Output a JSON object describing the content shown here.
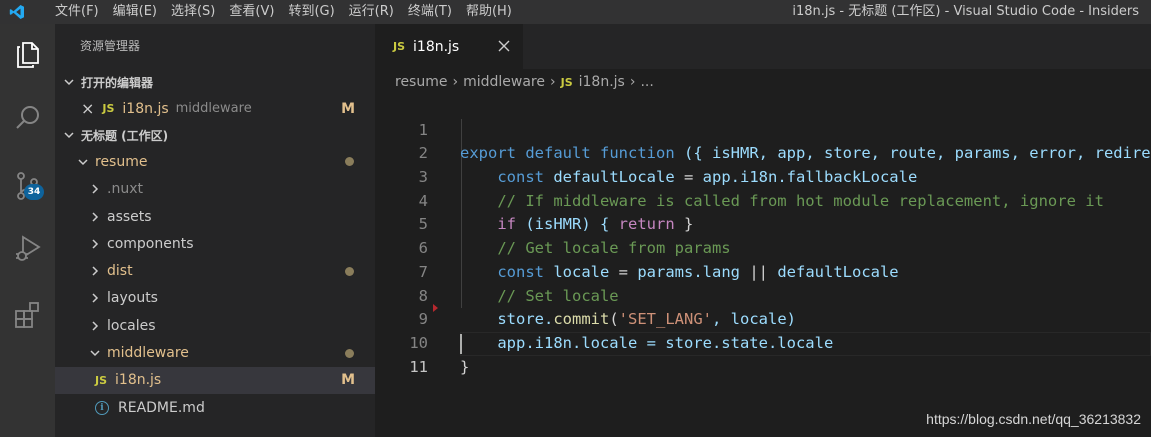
{
  "menu": [
    "文件(F)",
    "编辑(E)",
    "选择(S)",
    "查看(V)",
    "转到(G)",
    "运行(R)",
    "终端(T)",
    "帮助(H)"
  ],
  "window_title": "i18n.js - 无标题 (工作区) - Visual Studio Code - Insiders",
  "activity": {
    "icons": [
      "explorer-icon",
      "search-icon",
      "source-control-icon",
      "run-debug-icon",
      "extensions-icon"
    ],
    "scm_badge": "34"
  },
  "sidebar": {
    "title": "资源管理器",
    "open_editors_header": "打开的编辑器",
    "open_editor": {
      "close": "×",
      "name": "i18n.js",
      "folder": "middleware",
      "status": "M"
    },
    "workspace_header": "无标题 (工作区)",
    "tree": [
      {
        "name": "resume",
        "expanded": true,
        "modified": true
      },
      {
        "name": ".nuxt",
        "dim": true
      },
      {
        "name": "assets"
      },
      {
        "name": "components"
      },
      {
        "name": "dist",
        "modified": true
      },
      {
        "name": "layouts"
      },
      {
        "name": "locales"
      },
      {
        "name": "middleware",
        "expanded": true,
        "modified": true
      },
      {
        "name": "i18n.js",
        "status": "M",
        "selected": true
      },
      {
        "name": "README.md"
      }
    ]
  },
  "editor": {
    "tab_label": "i18n.js",
    "tab_icon": "JS",
    "breadcrumb": [
      "resume",
      "middleware",
      "i18n.js",
      "..."
    ],
    "line_numbers": [
      "1",
      "2",
      "3",
      "4",
      "5",
      "6",
      "7",
      "8",
      "9",
      "10",
      "11"
    ],
    "code": {
      "l1": {
        "export": "export",
        "default": "default",
        "function": "function",
        "params": "({ isHMR, app, store, route, params, error, redirect })"
      },
      "l2": {
        "const": "const",
        "name": "defaultLocale",
        "eq": " = ",
        "rhs": "app.i18n.fallbackLocale"
      },
      "l3": "// If middleware is called from hot module replacement, ignore it",
      "l4": {
        "if": "if",
        "cond": " (isHMR) { ",
        "ret": "return",
        "close": " }"
      },
      "l5": "// Get locale from params",
      "l6": {
        "const": "const",
        "name": "locale",
        "eq": " = ",
        "rhs1": "params.lang",
        "or": " || ",
        "rhs2": "defaultLocale"
      },
      "l7": "// Set locale",
      "l8": {
        "obj": "store.",
        "fn": "commit",
        "open": "(",
        "str": "'SET_LANG'",
        "rest": ", locale)"
      },
      "l9": "app.i18n.locale = store.state.locale",
      "l10": "}",
      "l11": ""
    }
  },
  "watermark": "https://blog.csdn.net/qq_36213832"
}
